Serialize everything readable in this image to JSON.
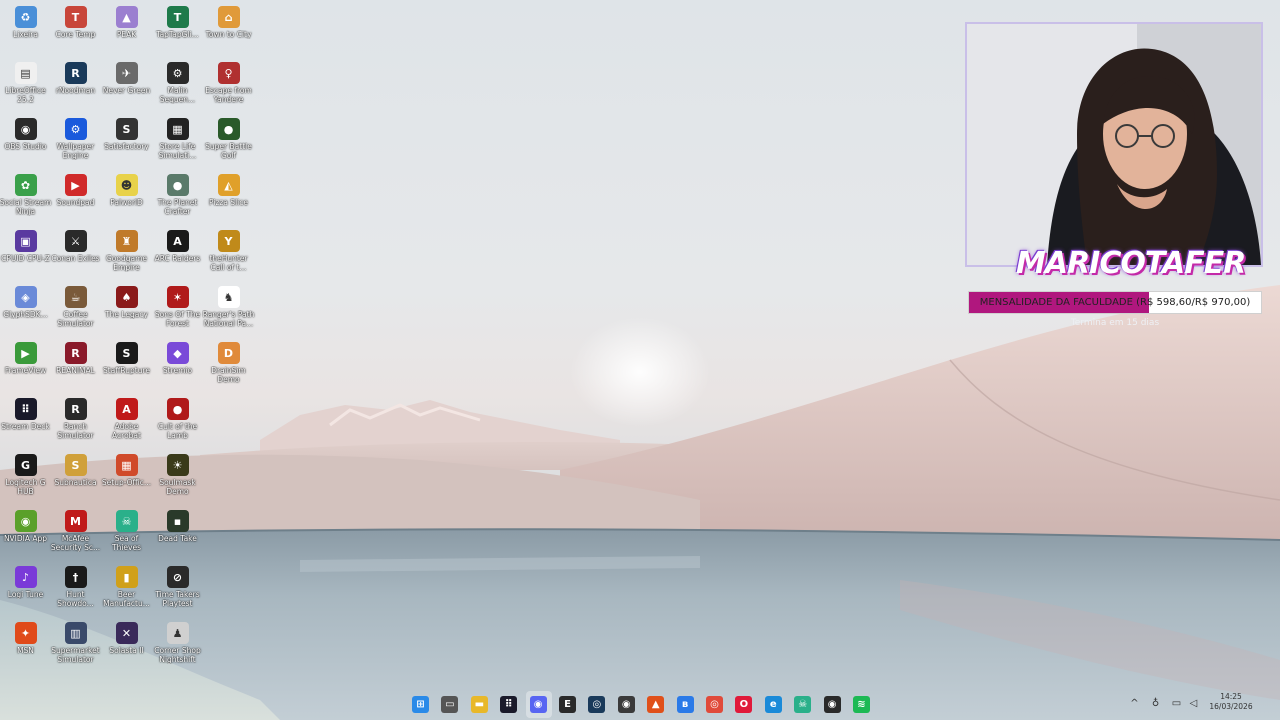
{
  "desktop": {
    "icons": [
      {
        "label": "Lixeira",
        "icon": "recycle-bin-icon",
        "color": "#4a8fd8",
        "glyph": "♻"
      },
      {
        "label": "Core Temp",
        "icon": "core-temp-icon",
        "color": "#c8463a",
        "glyph": "T"
      },
      {
        "label": "PEAK",
        "icon": "peak-icon",
        "color": "#9b7fd0",
        "glyph": "▲"
      },
      {
        "label": "TapTapGli...",
        "icon": "taptap-icon",
        "color": "#1e7a4a",
        "glyph": "T"
      },
      {
        "label": "Town to City",
        "icon": "town-to-city-icon",
        "color": "#e09a3a",
        "glyph": "⌂"
      },
      {
        "label": "LibreOffice 25.2",
        "icon": "libreoffice-icon",
        "color": "#f0f0f0",
        "glyph": "▤"
      },
      {
        "label": "rNoodman",
        "icon": "rnoodman-icon",
        "color": "#1a3a5a",
        "glyph": "R"
      },
      {
        "label": "Never Green",
        "icon": "never-green-icon",
        "color": "#6a6a6a",
        "glyph": "✈"
      },
      {
        "label": "Malin Sequen...",
        "icon": "malin-sequence-icon",
        "color": "#2a2a2a",
        "glyph": "⚙"
      },
      {
        "label": "Escape from Yandere",
        "icon": "escape-yandere-icon",
        "color": "#b03030",
        "glyph": "♀"
      },
      {
        "label": "OBS Studio",
        "icon": "obs-studio-icon",
        "color": "#2a2a2a",
        "glyph": "◉"
      },
      {
        "label": "Wallpaper Engine",
        "icon": "wallpaper-engine-icon",
        "color": "#1a5adc",
        "glyph": "⚙"
      },
      {
        "label": "Satisfactory",
        "icon": "satisfactory-icon",
        "color": "#333333",
        "glyph": "S"
      },
      {
        "label": "Store Life Simulati...",
        "icon": "store-life-icon",
        "color": "#222222",
        "glyph": "▦"
      },
      {
        "label": "Super Battle Golf",
        "icon": "super-battle-golf-icon",
        "color": "#2a5a2a",
        "glyph": "●"
      },
      {
        "label": "Social Stream Ninja",
        "icon": "social-stream-ninja-icon",
        "color": "#3aa04a",
        "glyph": "✿"
      },
      {
        "label": "Soundpad",
        "icon": "soundpad-icon",
        "color": "#d02a2a",
        "glyph": "▶"
      },
      {
        "label": "PalworlD",
        "icon": "palworld-icon",
        "color": "#e8d24a",
        "glyph": "☻"
      },
      {
        "label": "The Planet Crafter",
        "icon": "planet-crafter-icon",
        "color": "#5a7a6a",
        "glyph": "●"
      },
      {
        "label": "Pizza Slice",
        "icon": "pizza-slice-icon",
        "color": "#e0a02a",
        "glyph": "◭"
      },
      {
        "label": "CPUID CPU-Z",
        "icon": "cpu-z-icon",
        "color": "#5a3aa0",
        "glyph": "▣"
      },
      {
        "label": "Conan Exiles",
        "icon": "conan-exiles-icon",
        "color": "#2a2a2a",
        "glyph": "⚔"
      },
      {
        "label": "Goodgame Empire",
        "icon": "goodgame-empire-icon",
        "color": "#c07a2a",
        "glyph": "♜"
      },
      {
        "label": "ARC Raiders",
        "icon": "arc-raiders-icon",
        "color": "#1a1a1a",
        "glyph": "A"
      },
      {
        "label": "theHunter Call of t...",
        "icon": "thehunter-icon",
        "color": "#c08a1a",
        "glyph": "Y"
      },
      {
        "label": "GlyphSDK...",
        "icon": "glyph-sdk-icon",
        "color": "#6a8ad8",
        "glyph": "◈"
      },
      {
        "label": "Coffee Simulator",
        "icon": "coffee-simulator-icon",
        "color": "#7a5a3a",
        "glyph": "☕"
      },
      {
        "label": "The Legacy",
        "icon": "the-legacy-icon",
        "color": "#8a1a1a",
        "glyph": "♠"
      },
      {
        "label": "Sons Of The Forest",
        "icon": "sons-of-forest-icon",
        "color": "#b01a1a",
        "glyph": "✶"
      },
      {
        "label": "Ranger's Path National Pa...",
        "icon": "rangers-path-icon",
        "color": "#ffffff",
        "glyph": "♞"
      },
      {
        "label": "FrameView",
        "icon": "frameview-icon",
        "color": "#3a9a3a",
        "glyph": "▶"
      },
      {
        "label": "REANIMAL",
        "icon": "reanimal-icon",
        "color": "#8a1a2a",
        "glyph": "R"
      },
      {
        "label": "StaffRupture",
        "icon": "staffrupture-icon",
        "color": "#1a1a1a",
        "glyph": "S"
      },
      {
        "label": "Stremio",
        "icon": "stremio-icon",
        "color": "#7a4ad8",
        "glyph": "◆"
      },
      {
        "label": "DrainSim Demo",
        "icon": "drainsim-icon",
        "color": "#e08a3a",
        "glyph": "D"
      },
      {
        "label": "Stream Deck",
        "icon": "stream-deck-icon",
        "color": "#1a1a2a",
        "glyph": "⠿"
      },
      {
        "label": "Ranch Simulator",
        "icon": "ranch-simulator-icon",
        "color": "#2a2a2a",
        "glyph": "R"
      },
      {
        "label": "Adobe Acrobat",
        "icon": "adobe-acrobat-icon",
        "color": "#c01a1a",
        "glyph": "A"
      },
      {
        "label": "Cult of the Lamb",
        "icon": "cult-of-the-lamb-icon",
        "color": "#b01a1a",
        "glyph": "●"
      },
      {
        "label": "Logitech G HUB",
        "icon": "logitech-ghub-icon",
        "color": "#1a1a1a",
        "glyph": "G"
      },
      {
        "label": "Subnautica",
        "icon": "subnautica-icon",
        "color": "#d0a03a",
        "glyph": "S"
      },
      {
        "label": "Setup-Offic...",
        "icon": "setup-office-icon",
        "color": "#d04a2a",
        "glyph": "▦"
      },
      {
        "label": "Soulmask Demo",
        "icon": "soulmask-icon",
        "color": "#3a3a1a",
        "glyph": "☀"
      },
      {
        "label": "NVIDIA App",
        "icon": "nvidia-app-icon",
        "color": "#5aa02a",
        "glyph": "◉"
      },
      {
        "label": "McAfee Security Sc...",
        "icon": "mcafee-icon",
        "color": "#c01a1a",
        "glyph": "M"
      },
      {
        "label": "Sea of Thieves",
        "icon": "sea-of-thieves-icon",
        "color": "#2ab08a",
        "glyph": "☠"
      },
      {
        "label": "Dead Take",
        "icon": "dead-take-icon",
        "color": "#2a3a2a",
        "glyph": "▪"
      },
      {
        "label": "Logi Tune",
        "icon": "logi-tune-icon",
        "color": "#7a3ad8",
        "glyph": "♪"
      },
      {
        "label": "Hunt Showdo...",
        "icon": "hunt-showdown-icon",
        "color": "#1a1a1a",
        "glyph": "†"
      },
      {
        "label": "Beer Manufactu...",
        "icon": "beer-manufacture-icon",
        "color": "#d0a01a",
        "glyph": "▮"
      },
      {
        "label": "Time Takers Playtest",
        "icon": "time-takers-icon",
        "color": "#2a2a2a",
        "glyph": "⊘"
      },
      {
        "label": "MSN",
        "icon": "msn-icon",
        "color": "#e04a1a",
        "glyph": "✦"
      },
      {
        "label": "Supermarket Simulator",
        "icon": "supermarket-simulator-icon",
        "color": "#3a4a6a",
        "glyph": "▥"
      },
      {
        "label": "Solasta II",
        "icon": "solasta-icon",
        "color": "#3a2a5a",
        "glyph": "✕"
      },
      {
        "label": "Corner Shop Nightshift",
        "icon": "corner-shop-icon",
        "color": "#d0d0d0",
        "glyph": "♟"
      }
    ]
  },
  "overlay": {
    "streamer_name": "MARICOTAFER",
    "goal_text": "MENSALIDADE DA FACULDADE (R$ 598,60/R$ 970,00)",
    "goal_progress": 0.6171,
    "goal_subtext": "Termina em 15 dias",
    "accent_color": "#b0177e"
  },
  "taskbar": {
    "apps": [
      {
        "name": "start-button",
        "color": "#2a8ae8",
        "glyph": "⊞",
        "active": false
      },
      {
        "name": "task-view-icon",
        "color": "#555555",
        "glyph": "▭",
        "active": false
      },
      {
        "name": "file-explorer-icon",
        "color": "#e8b82a",
        "glyph": "▬",
        "active": false
      },
      {
        "name": "stream-deck-taskbar-icon",
        "color": "#1a1a2a",
        "glyph": "⠿",
        "active": false
      },
      {
        "name": "discord-icon",
        "color": "#5865f2",
        "glyph": "◉",
        "active": true
      },
      {
        "name": "epic-games-icon",
        "color": "#2a2a2a",
        "glyph": "E",
        "active": false
      },
      {
        "name": "steam-icon",
        "color": "#1a3a5a",
        "glyph": "◎",
        "active": false
      },
      {
        "name": "obs-taskbar-icon",
        "color": "#3a3a3a",
        "glyph": "◉",
        "active": false
      },
      {
        "name": "brave-browser-icon",
        "color": "#e0501a",
        "glyph": "▲",
        "active": false
      },
      {
        "name": "bluetooth-app-icon",
        "color": "#2a7ae8",
        "glyph": "ʙ",
        "active": false
      },
      {
        "name": "chrome-icon",
        "color": "#e04a3a",
        "glyph": "◎",
        "active": false
      },
      {
        "name": "opera-icon",
        "color": "#e01a3a",
        "glyph": "O",
        "active": false
      },
      {
        "name": "edge-icon",
        "color": "#1a8ad8",
        "glyph": "e",
        "active": false
      },
      {
        "name": "sea-of-thieves-taskbar-icon",
        "color": "#2ab08a",
        "glyph": "☠",
        "active": false
      },
      {
        "name": "obs-recording-icon",
        "color": "#2a2a2a",
        "glyph": "◉",
        "active": false
      },
      {
        "name": "spotify-icon",
        "color": "#1db954",
        "glyph": "≋",
        "active": false
      }
    ],
    "tray": [
      {
        "name": "tray-overflow-chevron-icon",
        "glyph": "^"
      },
      {
        "name": "microphone-icon",
        "glyph": "♁"
      },
      {
        "name": "network-icon",
        "glyph": "▭"
      },
      {
        "name": "volume-icon",
        "glyph": "◁"
      },
      {
        "name": "battery-icon",
        "glyph": "▯"
      }
    ],
    "time": "14:25",
    "date": "16/03/2026"
  }
}
